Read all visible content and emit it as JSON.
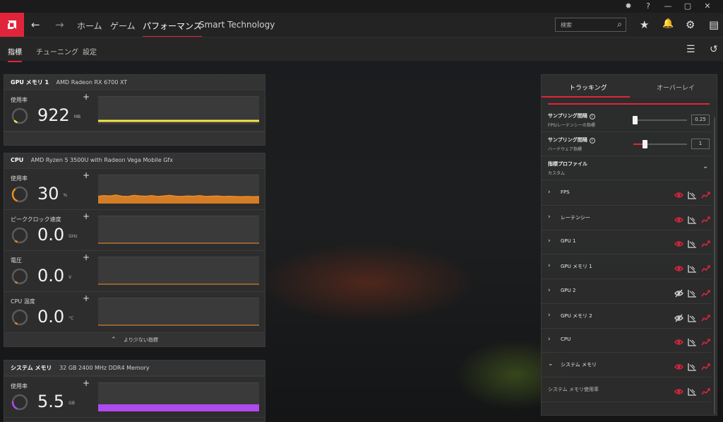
{
  "window": {
    "controls": [
      "bug-icon",
      "help-icon",
      "minimize-icon",
      "maximize-icon",
      "close-icon"
    ],
    "control_glyphs": [
      "✹",
      "?",
      "—",
      "▢",
      "✕"
    ]
  },
  "topnav": {
    "back": "←",
    "forward": "→",
    "items": [
      "ホーム",
      "ゲーム",
      "パフォーマンス",
      "Smart Technology"
    ],
    "active": "パフォーマンス",
    "search_placeholder": "検索",
    "search_glyph": "⌕",
    "icon_glyphs": [
      "★",
      "🔔",
      "⚙",
      "▤"
    ],
    "accent": "#e2243b"
  },
  "subnav": {
    "tabs": [
      "指標",
      "チューニング",
      "設定"
    ],
    "active": "指標",
    "right_icon_glyphs": [
      "☰",
      "↺"
    ]
  },
  "gpu_mem_panel": {
    "title": "GPU メモリ 1",
    "device": "AMD Radeon RX 6700 XT",
    "metrics": [
      {
        "label": "使用率",
        "value": "922",
        "unit": "MB",
        "color": "#f5e84a",
        "gauge": 0.05,
        "plus": "+"
      }
    ]
  },
  "cpu_panel": {
    "title": "CPU",
    "device": "AMD Ryzen 5 3500U with Radeon Vega Mobile Gfx",
    "metrics": [
      {
        "label": "使用率",
        "value": "30",
        "unit": "%",
        "color": "#f08a24",
        "gauge": 0.3,
        "plus": "+"
      },
      {
        "label": "ピーククロック速度",
        "value": "0.0",
        "unit": "GHz",
        "color": "#f08a24",
        "gauge": 0,
        "plus": "+"
      },
      {
        "label": "電圧",
        "value": "0.0",
        "unit": "V",
        "color": "#f08a24",
        "gauge": 0,
        "plus": "+"
      },
      {
        "label": "CPU 温度",
        "value": "0.0",
        "unit": "°C",
        "color": "#f08a24",
        "gauge": 0,
        "plus": "+"
      }
    ],
    "less_label": "より少ない指標",
    "less_glyph": "⌃"
  },
  "sys_mem_panel": {
    "title": "システム メモリ",
    "device": "32 GB 2400 MHz DDR4 Memory",
    "metrics": [
      {
        "label": "使用率",
        "value": "5.5",
        "unit": "GB",
        "color": "#b04af0",
        "gauge": 0.18,
        "plus": "+"
      }
    ]
  },
  "right_panel": {
    "tabs": [
      "トラッキング",
      "オーバーレイ"
    ],
    "active": "トラッキング",
    "sampling_fps": {
      "title": "サンプリング間隔",
      "subtitle": "FPS/レーテンシーの指標",
      "value": "0.25",
      "level": 0.0
    },
    "sampling_hw": {
      "title": "サンプリング間隔",
      "subtitle": "ハードウェア指標",
      "value": "1",
      "level": 0.18
    },
    "info_glyph": "i",
    "profile": {
      "title": "指標プロファイル",
      "subtitle": "カスタム",
      "glyph": "⌄"
    },
    "metrics": [
      {
        "name": "FPS",
        "visible": true,
        "expanded": false
      },
      {
        "name": "レーテンシー",
        "visible": true,
        "expanded": false
      },
      {
        "name": "GPU 1",
        "visible": true,
        "expanded": false
      },
      {
        "name": "GPU メモリ 1",
        "visible": true,
        "expanded": false
      },
      {
        "name": "GPU 2",
        "visible": false,
        "expanded": false
      },
      {
        "name": "GPU メモリ 2",
        "visible": false,
        "expanded": false
      },
      {
        "name": "CPU",
        "visible": true,
        "expanded": false
      },
      {
        "name": "システム メモリ",
        "visible": true,
        "expanded": true
      },
      {
        "name": "システム メモリ使用率",
        "visible": true,
        "child": true
      }
    ],
    "expand_glyph": "›",
    "collapse_glyph": "⌄"
  }
}
